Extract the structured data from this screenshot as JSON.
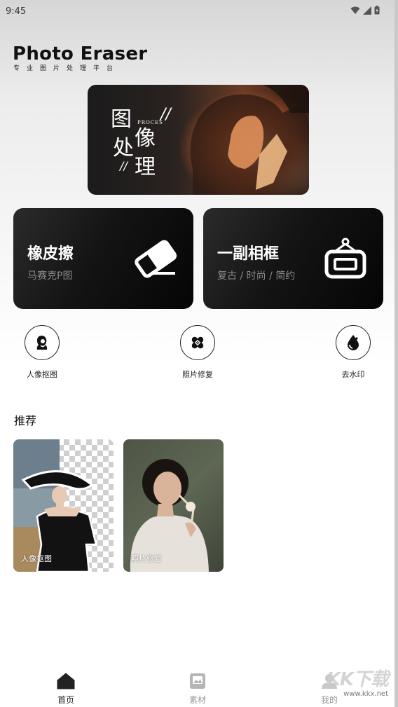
{
  "status_bar": {
    "time": "9:45"
  },
  "brand": {
    "title": "Photo Eraser",
    "subtitle": "专业图片处理平台"
  },
  "banner": {
    "chars": [
      "图",
      "处",
      "像",
      "理"
    ],
    "small_text": "PROCES"
  },
  "cards": [
    {
      "title": "橡皮擦",
      "subtitle": "马赛克P图",
      "icon": "eraser-icon"
    },
    {
      "title": "一副相框",
      "subtitle": "复古 / 时尚 / 简约",
      "icon": "frame-icon"
    }
  ],
  "tools": [
    {
      "label": "人像抠图",
      "icon": "portrait-cutout-icon"
    },
    {
      "label": "照片修复",
      "icon": "bandage-icon"
    },
    {
      "label": "去水印",
      "icon": "drop-icon"
    }
  ],
  "recommend": {
    "title": "推荐",
    "items": [
      {
        "label": "人像抠图"
      },
      {
        "label": "照片修复"
      }
    ]
  },
  "nav": {
    "items": [
      {
        "label": "首页",
        "icon": "home-icon",
        "active": true
      },
      {
        "label": "素材",
        "icon": "gallery-icon",
        "active": false
      },
      {
        "label": "我的",
        "icon": "profile-icon",
        "active": false
      }
    ]
  },
  "watermark": {
    "text": "KK下载",
    "url_text": "www.kkx.net"
  },
  "colors": {
    "card_bg": "#111111",
    "active_nav": "#222222",
    "inactive_nav": "#9a9a9a"
  }
}
